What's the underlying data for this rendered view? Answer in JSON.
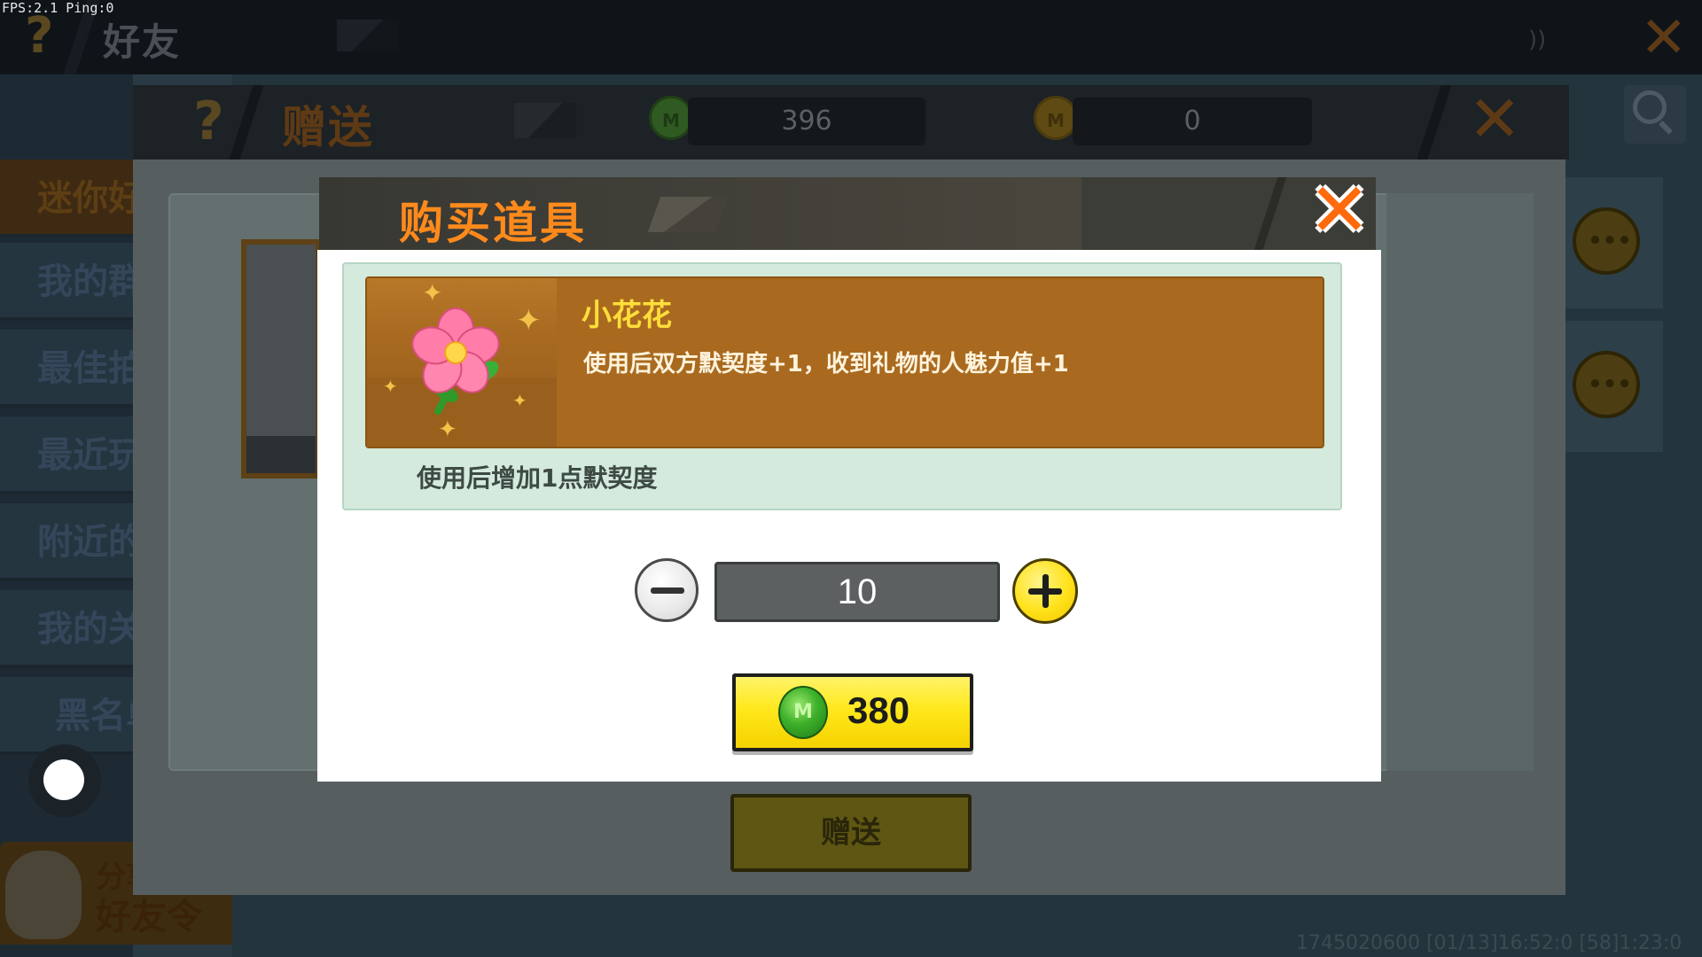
{
  "debug": {
    "fps_text": "FPS:2.1  Ping:0"
  },
  "friends_screen": {
    "title": "好友",
    "help_icon": "?",
    "close_icon": "✕",
    "sidebar": {
      "items": [
        {
          "label": "迷你好友",
          "active": true
        },
        {
          "label": "我的群组",
          "active": false
        },
        {
          "label": "最佳拍档",
          "active": false
        },
        {
          "label": "最近玩伴",
          "active": false
        },
        {
          "label": "附近的人",
          "active": false
        },
        {
          "label": "我的关注",
          "active": false
        },
        {
          "label": "黑名单",
          "active": false
        }
      ]
    },
    "friend_token": {
      "line1": "分享",
      "line2": "好友令"
    },
    "footer_id": "1745020600   [01/13]16:52:0   [58]1:23:0"
  },
  "gift_panel": {
    "title": "赠送",
    "help_icon": "?",
    "currency": {
      "gem_icon": "M",
      "gem_value": "396",
      "gold_icon": "M",
      "gold_value": "0"
    },
    "close_icon": "✕",
    "send_label": "赠送"
  },
  "purchase_dialog": {
    "title": "购买道具",
    "close_icon": "✕",
    "item": {
      "name": "小花花",
      "effect": "使用后双方默契度+1，收到礼物的人魅力值+1",
      "sub_description": "使用后增加1点默契度"
    },
    "quantity": "10",
    "price_icon": "M",
    "price": "380"
  },
  "colors": {
    "accent_orange": "#ff8a1c",
    "buy_yellow": "#ffe81c",
    "item_banner": "#a96a20"
  }
}
